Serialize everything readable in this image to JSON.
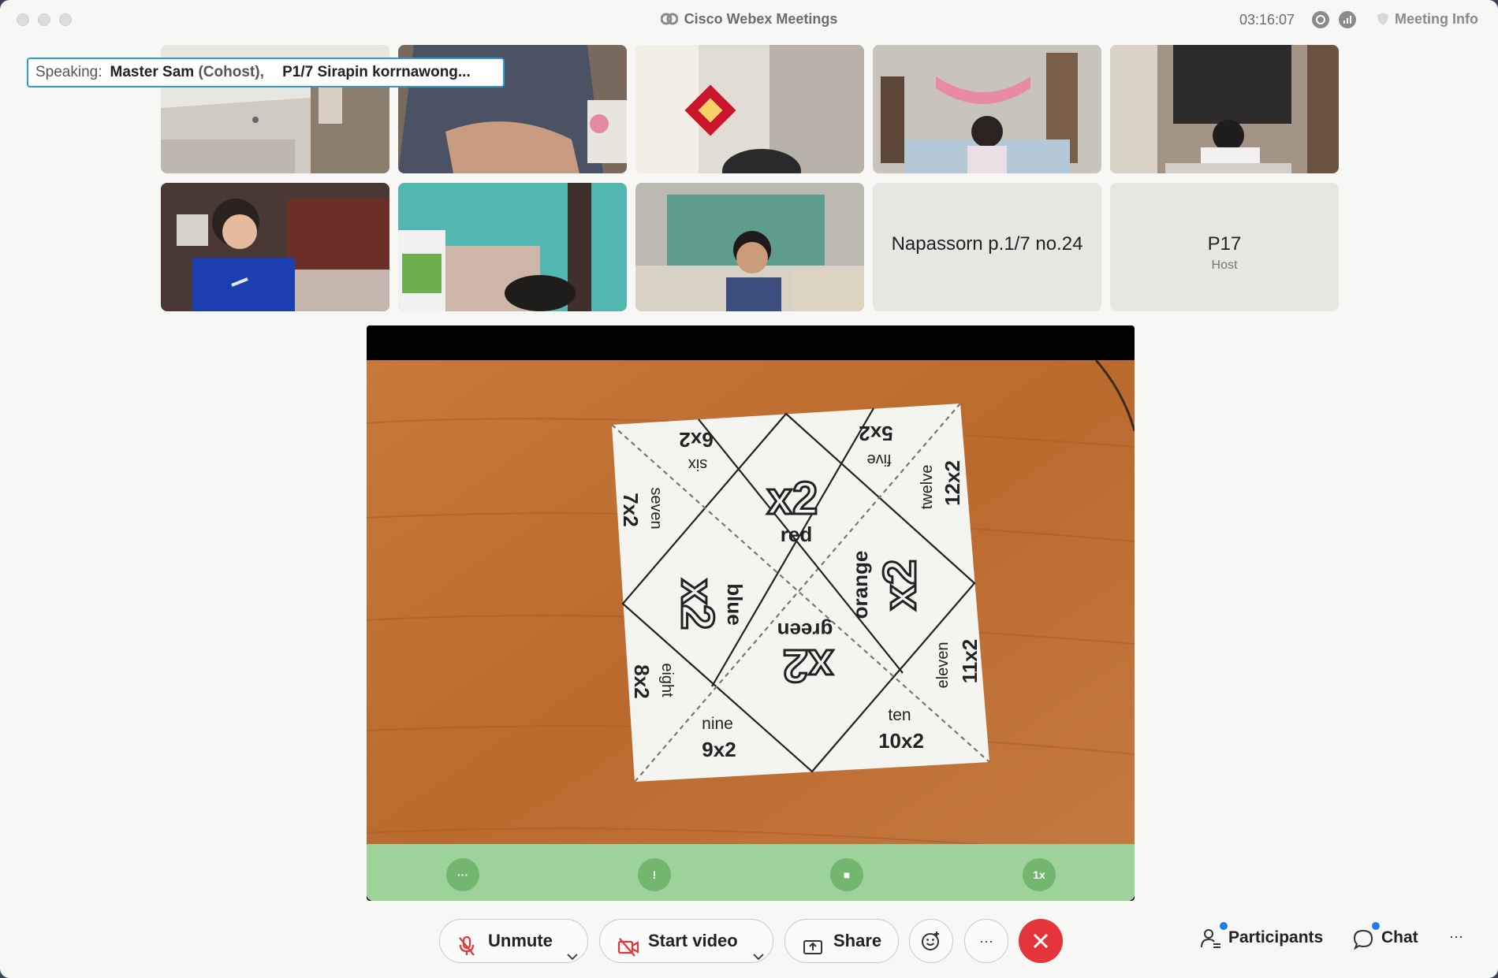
{
  "window": {
    "app_title": "Cisco Webex Meetings",
    "clock": "03:16:07",
    "meeting_info_label": "Meeting Info"
  },
  "speaking": {
    "label": "Speaking:",
    "speaker1_name": "Master Sam",
    "speaker1_role": "(Cohost)",
    "separator": ",",
    "speaker2_name": "P1/7 Sirapin korrnawong..."
  },
  "tiles": [
    {
      "type": "video",
      "scene": "ceiling-room"
    },
    {
      "type": "video",
      "scene": "adult-shirt"
    },
    {
      "type": "video",
      "scene": "decor-wall"
    },
    {
      "type": "video",
      "scene": "girl-room"
    },
    {
      "type": "video",
      "scene": "boy-desk"
    },
    {
      "type": "video",
      "scene": "boy-blue-shirt"
    },
    {
      "type": "video",
      "scene": "teal-room"
    },
    {
      "type": "video",
      "scene": "boy-window"
    },
    {
      "type": "name",
      "name": "Napassorn p.1/7 no.24",
      "role": ""
    },
    {
      "type": "name",
      "name": "P17",
      "role": "Host"
    }
  ],
  "shared_content": {
    "fortune_teller": {
      "top_left_outer": "6x2",
      "top_left_inner": "six",
      "top_right_outer": "5x2",
      "top_right_inner": "five",
      "left_top_outer": "7x2",
      "left_top_inner": "seven",
      "right_top_outer": "12x2",
      "right_top_inner": "twelve",
      "left_bottom_outer": "8x2",
      "left_bottom_inner": "eight",
      "right_bottom_outer": "11x2",
      "right_bottom_inner": "eleven",
      "bottom_left_outer": "9x2",
      "bottom_left_inner": "nine",
      "bottom_right_outer": "10x2",
      "bottom_right_inner": "ten",
      "center_top_big": "x2",
      "center_top_color": "red",
      "center_left_big": "x2",
      "center_left_color": "blue",
      "center_right_big": "x2",
      "center_right_color": "orange",
      "center_bottom_big": "x2",
      "center_bottom_color": "green"
    },
    "playbar": {
      "more_label": "···",
      "pointer_label": "!",
      "stop_label": "■",
      "speed_label": "1x"
    }
  },
  "toolbar": {
    "unmute_label": "Unmute",
    "start_video_label": "Start video",
    "share_label": "Share",
    "more_label": "···",
    "participants_label": "Participants",
    "chat_label": "Chat",
    "overflow_label": "···"
  },
  "colors": {
    "accent_blue": "#2e9bd6",
    "leave_red": "#e5343a",
    "playbar_green": "#9dd39a",
    "mute_red": "#e5343a"
  }
}
